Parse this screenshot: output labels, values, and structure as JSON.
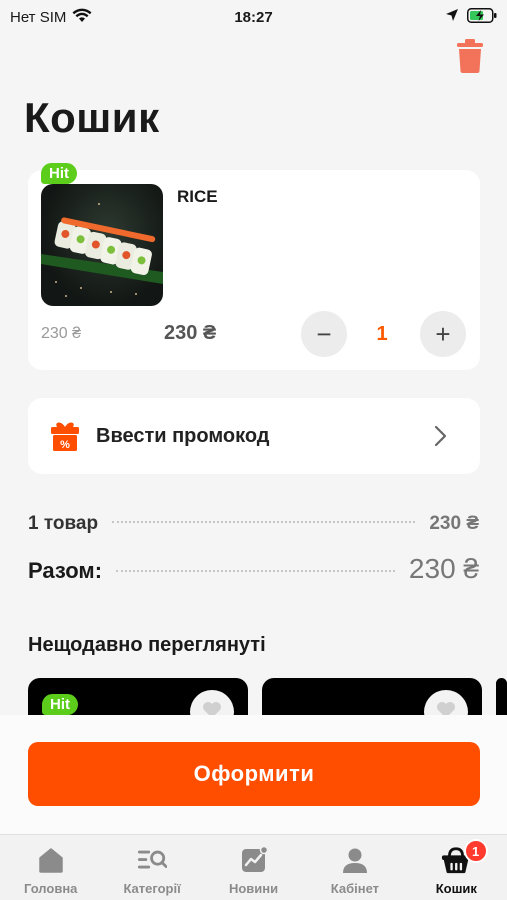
{
  "status_bar": {
    "carrier": "Нет SIM",
    "time": "18:27"
  },
  "page": {
    "title": "Кошик"
  },
  "cart_item": {
    "badge": "Hit",
    "name": "RICE",
    "old_price": "230 ₴",
    "price": "230 ₴",
    "quantity": "1",
    "decrement_label": "−",
    "increment_label": "+"
  },
  "promo": {
    "label": "Ввести промокод"
  },
  "summary": {
    "items_label": "1 товар",
    "items_value": "230 ₴",
    "total_label": "Разом:",
    "total_value": "230 ₴"
  },
  "recent": {
    "title": "Нещодавно переглянуті",
    "cards": [
      {
        "badge": "Hit"
      },
      {
        "badge": ""
      }
    ]
  },
  "checkout": {
    "label": "Оформити"
  },
  "tabs": [
    {
      "label": "Головна",
      "icon": "home-icon"
    },
    {
      "label": "Категорії",
      "icon": "categories-icon"
    },
    {
      "label": "Новини",
      "icon": "news-icon"
    },
    {
      "label": "Кабінет",
      "icon": "profile-icon"
    },
    {
      "label": "Кошик",
      "icon": "basket-icon",
      "badge": "1",
      "active": true
    }
  ],
  "colors": {
    "accent": "#ff4e00",
    "hit_badge": "#5ccd1a",
    "cart_badge": "#ff3b30",
    "trash": "#f2735a"
  }
}
